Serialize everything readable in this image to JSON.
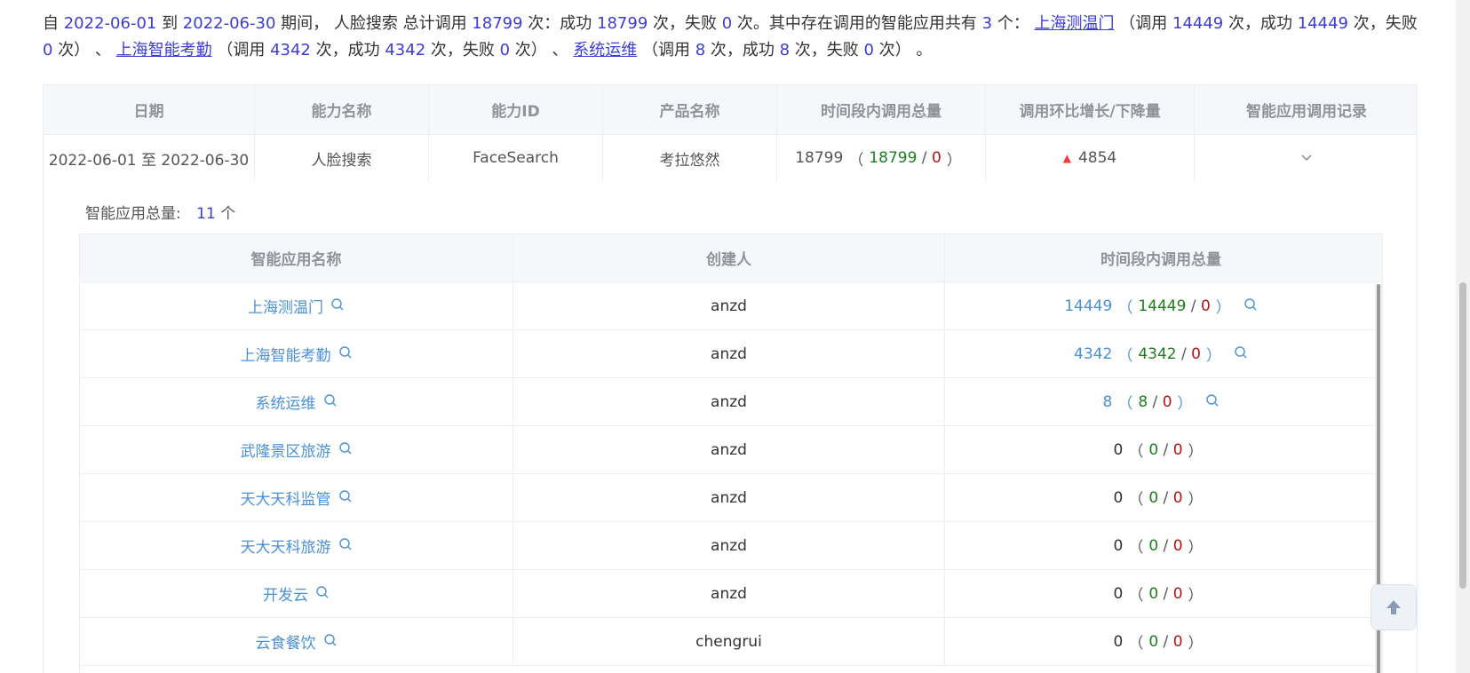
{
  "summary": {
    "p1": "自 ",
    "start_date": "2022-06-01",
    "p2": " 到 ",
    "end_date": "2022-06-30",
    "p3": " 期间， 人脸搜索 总计调用 ",
    "total": "18799",
    "p4": " 次：成功 ",
    "success": "18799",
    "p5": " 次，失败 ",
    "fail": "0",
    "p6": " 次。其中存在调用的智能应用共有 ",
    "app_count": "3",
    "p7": " 个： ",
    "app1_name": "上海测温门",
    "p8": " （调用 ",
    "app1_calls": "14449",
    "p9": " 次，成功 ",
    "app1_success": "14449",
    "p10": " 次，失败 ",
    "app1_fail": "0",
    "p11": " 次） 、 ",
    "app2_name": "上海智能考勤",
    "p12": " （调用 ",
    "app2_calls": "4342",
    "p13": " 次，成功 ",
    "app2_success": "4342",
    "p14": " 次，失败 ",
    "app2_fail": "0",
    "p15": " 次） 、 ",
    "app3_name": "系统运维",
    "p16": " （调用 ",
    "app3_calls": "8",
    "p17": " 次，成功 ",
    "app3_success": "8",
    "p18": " 次，失败 ",
    "app3_fail": "0",
    "p19": " 次） 。"
  },
  "main_table": {
    "headers": [
      "日期",
      "能力名称",
      "能力ID",
      "产品名称",
      "时间段内调用总量",
      "调用环比增长/下降量",
      "智能应用调用记录"
    ],
    "row": {
      "date": "2022-06-01 至 2022-06-30",
      "ability_name": "人脸搜索",
      "ability_id": "FaceSearch",
      "product": "考拉悠然",
      "total": "18799",
      "success": "18799",
      "fail": "0",
      "growth": "4854"
    }
  },
  "expand": {
    "total_label": "智能应用总量:",
    "total_value": "11",
    "total_unit": "个",
    "headers": [
      "智能应用名称",
      "创建人",
      "时间段内调用总量"
    ],
    "rows": [
      {
        "name": "上海测温门",
        "creator": "anzd",
        "total": "14449",
        "success": "14449",
        "fail": "0"
      },
      {
        "name": "上海智能考勤",
        "creator": "anzd",
        "total": "4342",
        "success": "4342",
        "fail": "0"
      },
      {
        "name": "系统运维",
        "creator": "anzd",
        "total": "8",
        "success": "8",
        "fail": "0"
      },
      {
        "name": "武隆景区旅游",
        "creator": "anzd",
        "total": "0",
        "success": "0",
        "fail": "0"
      },
      {
        "name": "天大天科监管",
        "creator": "anzd",
        "total": "0",
        "success": "0",
        "fail": "0"
      },
      {
        "name": "天大天科旅游",
        "creator": "anzd",
        "total": "0",
        "success": "0",
        "fail": "0"
      },
      {
        "name": "开发云",
        "creator": "anzd",
        "total": "0",
        "success": "0",
        "fail": "0"
      },
      {
        "name": "云食餐饮",
        "creator": "chengrui",
        "total": "0",
        "success": "0",
        "fail": "0"
      }
    ]
  },
  "colors": {
    "accent_blue": "#3c3cd6",
    "link_blue": "#4a90d9",
    "success_green": "#1e7e1e",
    "fail_red": "#b01515",
    "up_arrow": "#f03c3c"
  },
  "icons": {
    "search": "search-icon",
    "chevron": "chevron-down-icon",
    "back_top": "arrow-up-icon"
  }
}
